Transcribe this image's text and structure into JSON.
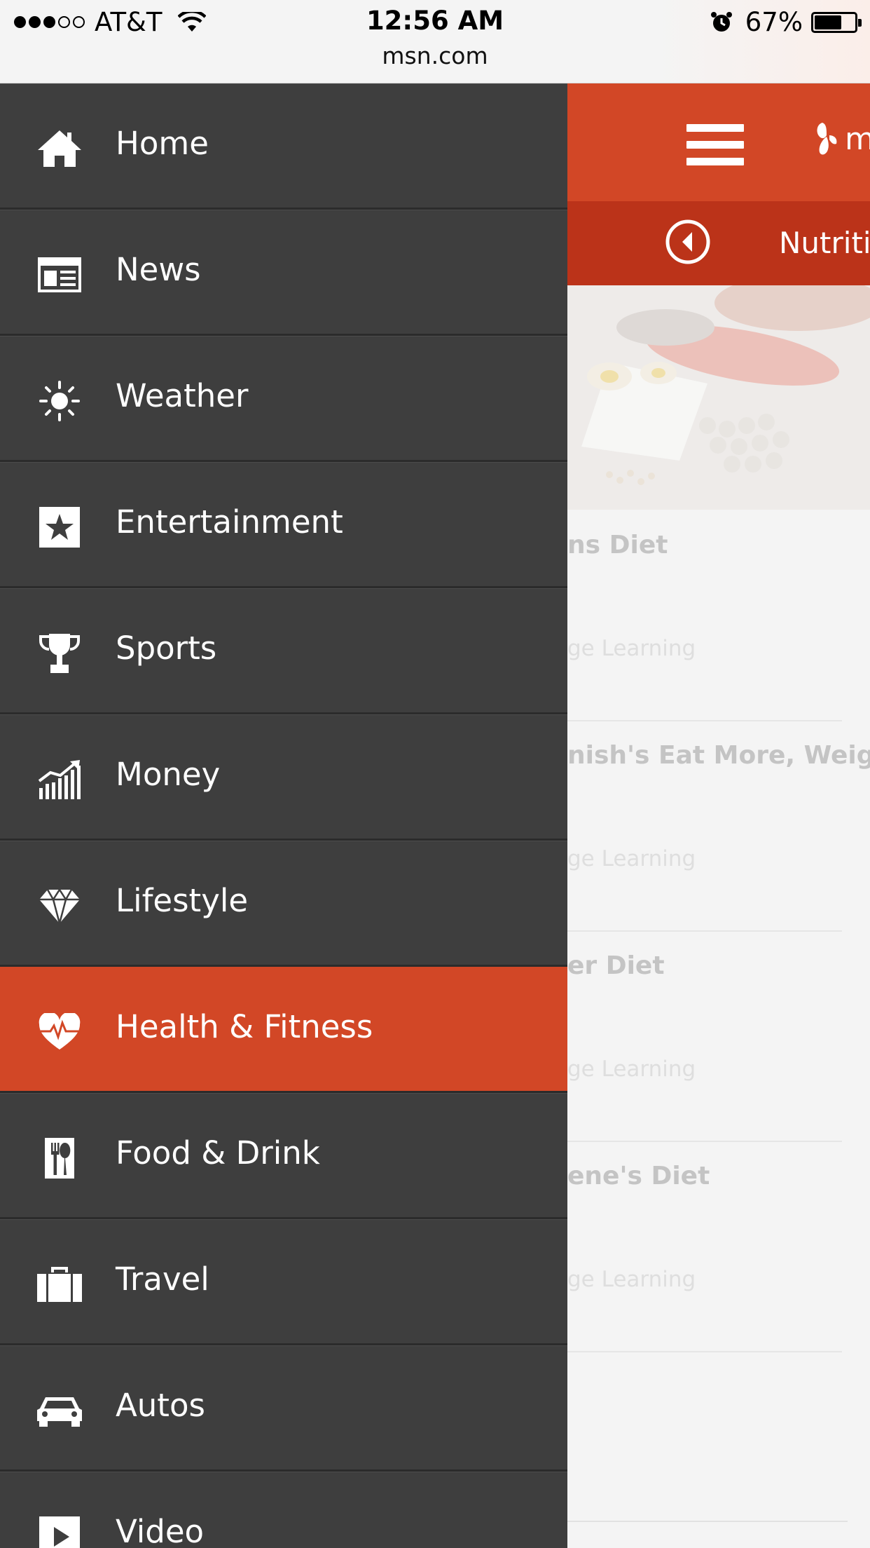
{
  "status_bar": {
    "carrier": "AT&T",
    "time": "12:56 AM",
    "url": "msn.com",
    "battery": "67%",
    "battery_level": 0.67,
    "signal_bars": 3
  },
  "menu": {
    "items": [
      {
        "label": "Home",
        "icon": "home-icon"
      },
      {
        "label": "News",
        "icon": "newspaper-icon"
      },
      {
        "label": "Weather",
        "icon": "sun-icon"
      },
      {
        "label": "Entertainment",
        "icon": "star-icon"
      },
      {
        "label": "Sports",
        "icon": "trophy-icon"
      },
      {
        "label": "Money",
        "icon": "chart-icon"
      },
      {
        "label": "Lifestyle",
        "icon": "diamond-icon"
      },
      {
        "label": "Health & Fitness",
        "icon": "heart-pulse-icon",
        "active": true
      },
      {
        "label": "Food & Drink",
        "icon": "fork-knife-icon"
      },
      {
        "label": "Travel",
        "icon": "suitcase-icon"
      },
      {
        "label": "Autos",
        "icon": "car-icon"
      },
      {
        "label": "Video",
        "icon": "play-icon"
      }
    ]
  },
  "page": {
    "logo_text": "m",
    "section_title": "Nutriti",
    "articles": [
      {
        "title": "ns Diet",
        "source": "ge Learning"
      },
      {
        "title": "nish's Eat More, Weigh",
        "source": "ge Learning"
      },
      {
        "title": "er Diet",
        "source": "ge Learning"
      },
      {
        "title": "ene's Diet",
        "source": "ge Learning"
      }
    ]
  },
  "colors": {
    "accent": "#d24726",
    "accent_dark": "#bb3319",
    "menu_bg": "#3e3e3e",
    "menu_text": "#ffffff"
  }
}
